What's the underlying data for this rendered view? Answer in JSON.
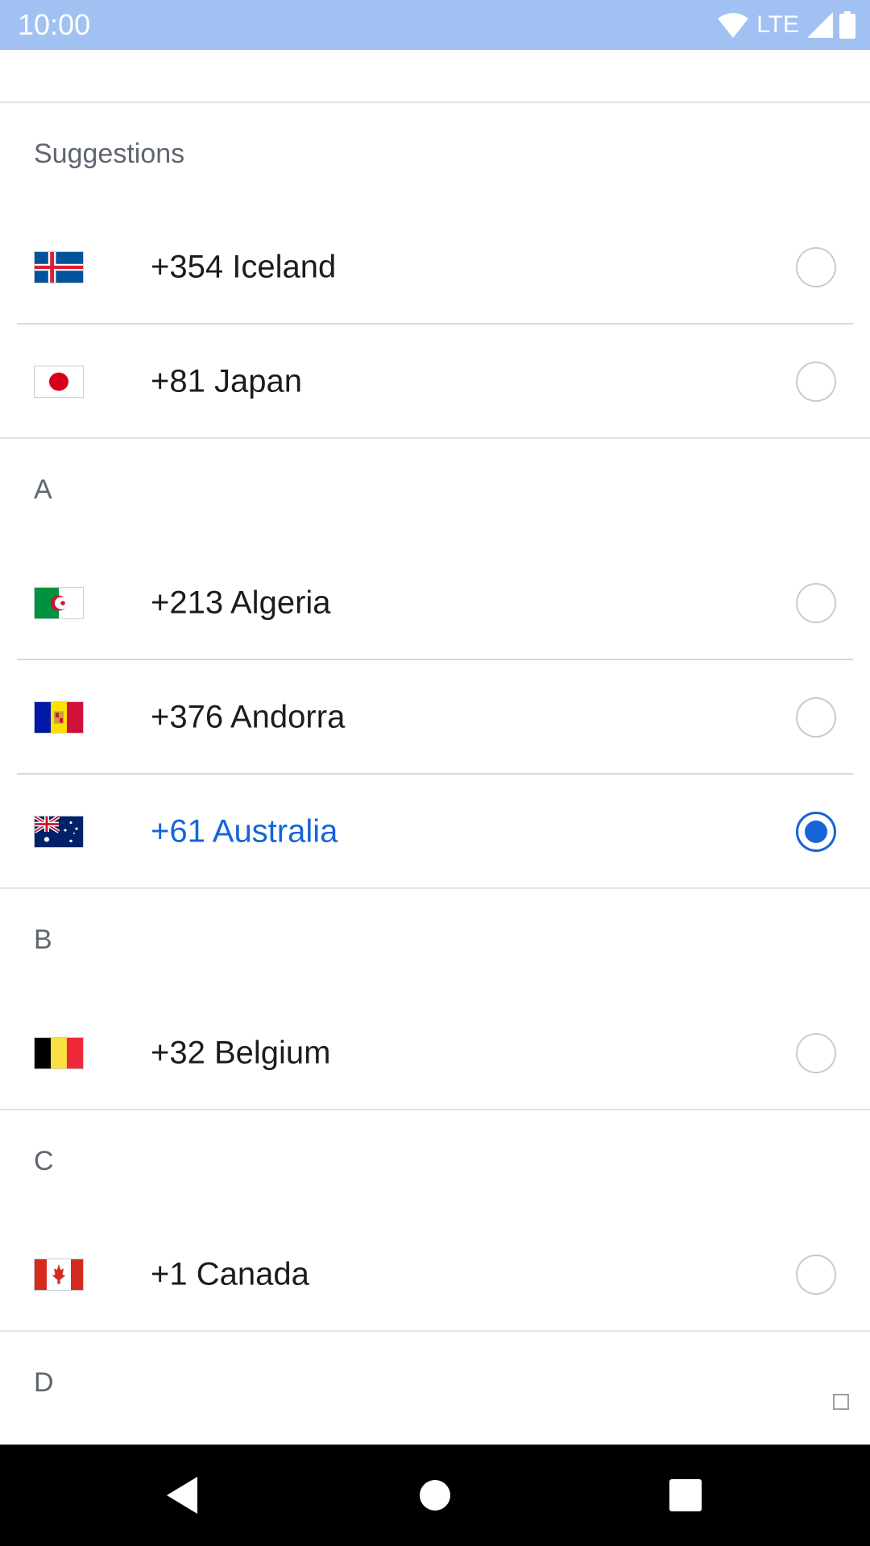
{
  "status_bar": {
    "time": "10:00",
    "network": "LTE",
    "icons": [
      "wifi-icon",
      "signal-icon",
      "battery-icon"
    ]
  },
  "colors": {
    "status_bar_bg": "#a0c1f2",
    "accent": "#1565d8",
    "divider": "#d4d9df"
  },
  "sections": [
    {
      "title": "Suggestions",
      "items": [
        {
          "label": "+354 Iceland",
          "flag": "iceland-flag-icon",
          "selected": false
        },
        {
          "label": "+81 Japan",
          "flag": "japan-flag-icon",
          "selected": false
        }
      ]
    },
    {
      "title": "A",
      "items": [
        {
          "label": "+213 Algeria",
          "flag": "algeria-flag-icon",
          "selected": false
        },
        {
          "label": "+376 Andorra",
          "flag": "andorra-flag-icon",
          "selected": false
        },
        {
          "label": "+61 Australia",
          "flag": "australia-flag-icon",
          "selected": true
        }
      ]
    },
    {
      "title": "B",
      "items": [
        {
          "label": "+32 Belgium",
          "flag": "belgium-flag-icon",
          "selected": false
        }
      ]
    },
    {
      "title": "C",
      "items": [
        {
          "label": "+1 Canada",
          "flag": "canada-flag-icon",
          "selected": false
        }
      ]
    },
    {
      "title": "D",
      "items": []
    }
  ],
  "nav_bar": {
    "buttons": [
      "back-icon",
      "home-icon",
      "recents-icon"
    ]
  }
}
